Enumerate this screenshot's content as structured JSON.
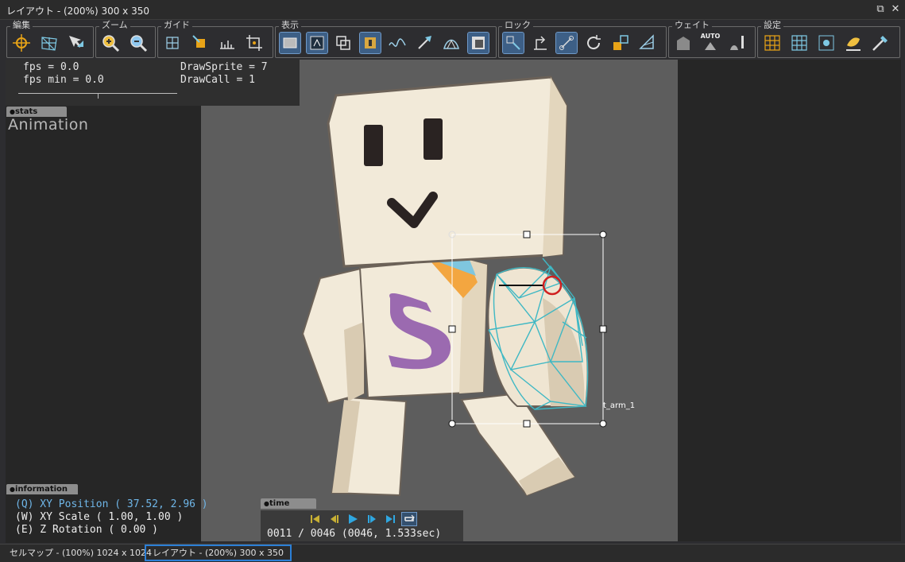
{
  "window": {
    "title": "レイアウト - (200%) 300 x 350"
  },
  "toolbar": {
    "groups": [
      {
        "label": "編集"
      },
      {
        "label": "ズーム"
      },
      {
        "label": "ガイド"
      },
      {
        "label": "表示"
      },
      {
        "label": "ロック"
      },
      {
        "label": "ウェイト"
      },
      {
        "label": "設定"
      }
    ],
    "weight_auto_label": "AUTO"
  },
  "stats_panel": {
    "fps": "fps = 0.0",
    "fps_min": "fps min = 0.0",
    "draw_sprite": "DrawSprite = 7",
    "draw_call": "DrawCall = 1",
    "tag": "stats"
  },
  "animation_label": "Animation",
  "canvas": {
    "part_label": "t_arm_1"
  },
  "info_panel": {
    "tag": "information",
    "position": "(Q) XY Position ( 37.52, 2.96 )",
    "scale": "(W) XY Scale ( 1.00, 1.00 )",
    "rotation": "(E) Z Rotation ( 0.00 )"
  },
  "time_panel": {
    "tag": "time",
    "frame": "0011 / 0046 (0046, 1.533sec)"
  },
  "statusbar": {
    "tabs": [
      {
        "label": "セルマップ - (100%) 1024 x 1024",
        "active": false
      },
      {
        "label": "レイアウト - (200%) 300 x 350",
        "active": true
      }
    ]
  },
  "colors": {
    "accent": "#2b7fd6",
    "mesh": "#3fb8c4",
    "position_text": "#6fb6e8",
    "play": "#2fa7e0",
    "nav": "#c8b034"
  }
}
